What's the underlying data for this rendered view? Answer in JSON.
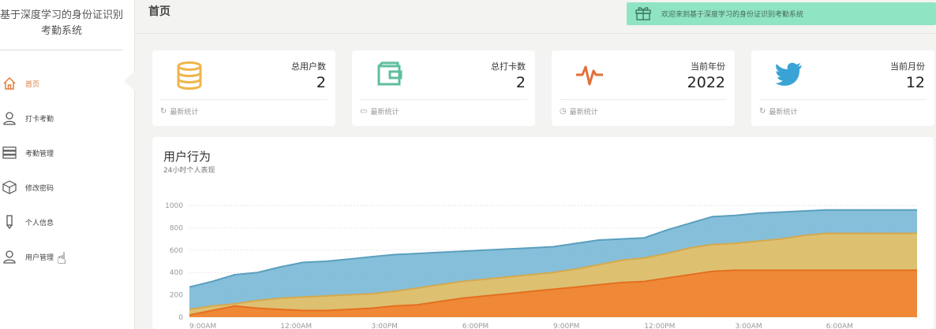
{
  "sidebar": {
    "brand_line1": "基于深度学习的身份证识别",
    "brand_line2": "考勤系统",
    "items": [
      {
        "label": "首页",
        "icon": "home-icon"
      },
      {
        "label": "打卡考勤",
        "icon": "user-icon"
      },
      {
        "label": "考勤管理",
        "icon": "server-icon"
      },
      {
        "label": "修改密码",
        "icon": "cube-icon"
      },
      {
        "label": "个人信息",
        "icon": "pen-icon"
      },
      {
        "label": "用户管理",
        "icon": "user-icon"
      }
    ]
  },
  "header": {
    "title": "首页",
    "notice": "欢迎来到基于深度学习的身份证识别考勤系统"
  },
  "stats": [
    {
      "label": "总用户数",
      "value": "2",
      "footer": "最新统计",
      "icon": "database-icon",
      "color": "#efb54a"
    },
    {
      "label": "总打卡数",
      "value": "2",
      "footer": "最新统计",
      "icon": "wallet-icon",
      "color": "#5fbf9d"
    },
    {
      "label": "当前年份",
      "value": "2022",
      "footer": "最新统计",
      "icon": "pulse-icon",
      "color": "#e26f3a"
    },
    {
      "label": "当前月份",
      "value": "12",
      "footer": "最新统计",
      "icon": "twitter-icon",
      "color": "#3aa3d6"
    }
  ],
  "panel": {
    "title": "用户行为",
    "subtitle": "24小时个人表现"
  },
  "chart_data": {
    "type": "area",
    "stacked": true,
    "x": [
      "9:00AM",
      "12:00AM",
      "3:00PM",
      "6:00PM",
      "9:00PM",
      "12:00PM",
      "3:00AM",
      "6:00AM"
    ],
    "x_points": [
      0,
      0.25,
      0.5,
      0.75,
      1,
      1.25,
      1.5,
      1.75,
      2,
      2.25,
      2.5,
      2.75,
      3,
      3.25,
      3.5,
      3.75,
      4,
      4.25,
      4.5,
      4.75,
      5,
      5.25,
      5.5,
      5.75,
      6,
      6.25,
      6.5,
      6.75,
      7,
      7.5,
      8
    ],
    "ylim": [
      0,
      1000
    ],
    "yticks": [
      0,
      200,
      400,
      600,
      800,
      1000
    ],
    "grid": true,
    "series": [
      {
        "color": "#f08433",
        "values": [
          20,
          60,
          100,
          80,
          70,
          60,
          60,
          70,
          80,
          100,
          110,
          140,
          170,
          190,
          210,
          230,
          250,
          270,
          290,
          310,
          320,
          350,
          380,
          410,
          420,
          420,
          420,
          420,
          420,
          420,
          420
        ]
      },
      {
        "color": "#e6c068",
        "values": [
          70,
          100,
          120,
          150,
          170,
          180,
          190,
          200,
          210,
          230,
          260,
          290,
          320,
          340,
          360,
          380,
          400,
          430,
          470,
          510,
          530,
          570,
          620,
          650,
          660,
          680,
          700,
          730,
          750,
          750,
          750
        ]
      },
      {
        "color": "#7cbad6",
        "values": [
          270,
          320,
          380,
          400,
          450,
          490,
          500,
          520,
          540,
          560,
          570,
          580,
          590,
          600,
          610,
          620,
          630,
          660,
          690,
          700,
          710,
          780,
          840,
          900,
          910,
          930,
          940,
          950,
          960,
          960,
          960
        ]
      }
    ]
  }
}
